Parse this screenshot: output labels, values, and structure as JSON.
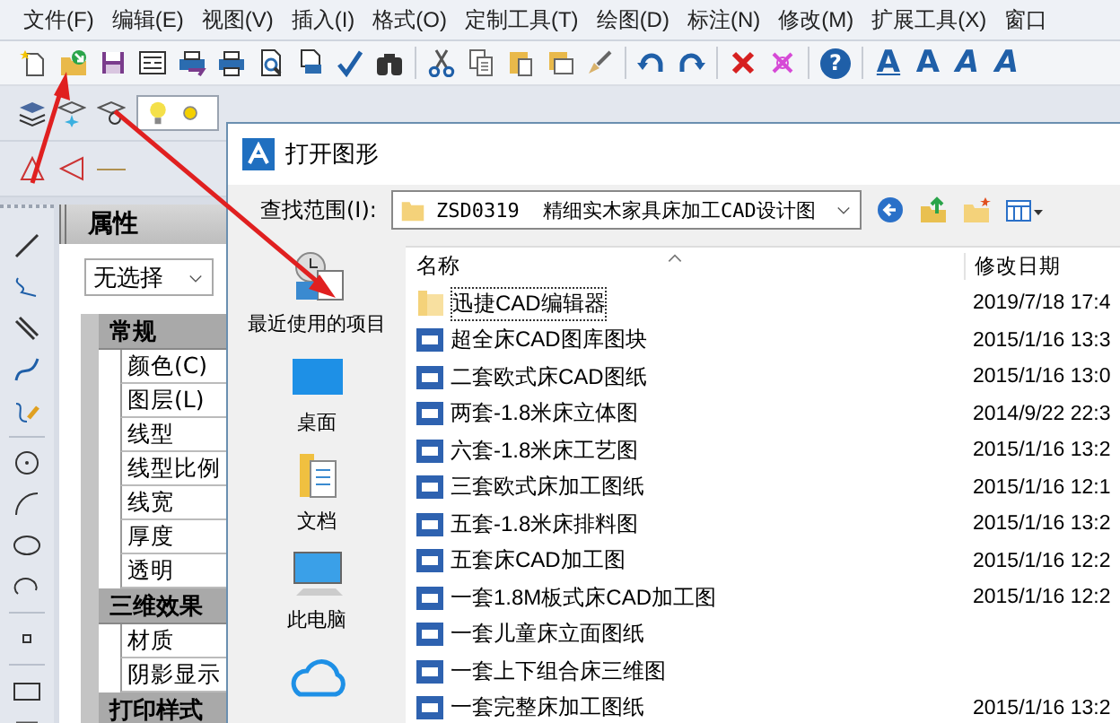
{
  "menu": [
    "文件(F)",
    "编辑(E)",
    "视图(V)",
    "插入(I)",
    "格式(O)",
    "定制工具(T)",
    "绘图(D)",
    "标注(N)",
    "修改(M)",
    "扩展工具(X)",
    "窗口"
  ],
  "toolbar": [
    "?",
    "A",
    "A",
    "A",
    "A"
  ],
  "properties": {
    "title": "属性",
    "selection": "无选择",
    "groups": [
      {
        "name": "常规",
        "items": [
          "颜色(C)",
          "图层(L)",
          "线型",
          "线型比例",
          "线宽",
          "厚度",
          "透明"
        ]
      },
      {
        "name": "三维效果",
        "items": [
          "材质",
          "阴影显示"
        ]
      },
      {
        "name": "打印样式"
      }
    ]
  },
  "dialog": {
    "title": "打开图形",
    "look_in_label": "查找范围(I):",
    "look_in": "ZSD0319  精细实木家具床加工CAD设计图",
    "places": [
      "最近使用的项目",
      "桌面",
      "文档",
      "此电脑"
    ],
    "columns": [
      "名称",
      "修改日期"
    ],
    "files": [
      {
        "kind": "folder",
        "name": "迅捷CAD编辑器",
        "date": "2019/7/18 17:4",
        "selected": true
      },
      {
        "kind": "cad",
        "name": "超全床CAD图库图块",
        "date": "2015/1/16 13:3",
        "selected": false
      },
      {
        "kind": "cad",
        "name": "二套欧式床CAD图纸",
        "date": "2015/1/16 13:0",
        "selected": false
      },
      {
        "kind": "cad",
        "name": "两套-1.8米床立体图",
        "date": "2014/9/22 22:3",
        "selected": false
      },
      {
        "kind": "cad",
        "name": "六套-1.8米床工艺图",
        "date": "2015/1/16 13:2",
        "selected": false
      },
      {
        "kind": "cad",
        "name": "三套欧式床加工图纸",
        "date": "2015/1/16 12:1",
        "selected": false
      },
      {
        "kind": "cad",
        "name": "五套-1.8米床排料图",
        "date": "2015/1/16 13:2",
        "selected": false
      },
      {
        "kind": "cad",
        "name": "五套床CAD加工图",
        "date": "2015/1/16 12:2",
        "selected": false
      },
      {
        "kind": "cad",
        "name": "一套1.8M板式床CAD加工图",
        "date": "2015/1/16 12:2",
        "selected": false
      },
      {
        "kind": "cad",
        "name": "一套儿童床立面图纸",
        "selected": false
      },
      {
        "kind": "cad",
        "name": "一套上下组合床三维图",
        "selected": false
      },
      {
        "kind": "cad",
        "name": "一套完整床加工图纸",
        "date": "2015/1/16 13:2",
        "selected": false
      }
    ]
  }
}
